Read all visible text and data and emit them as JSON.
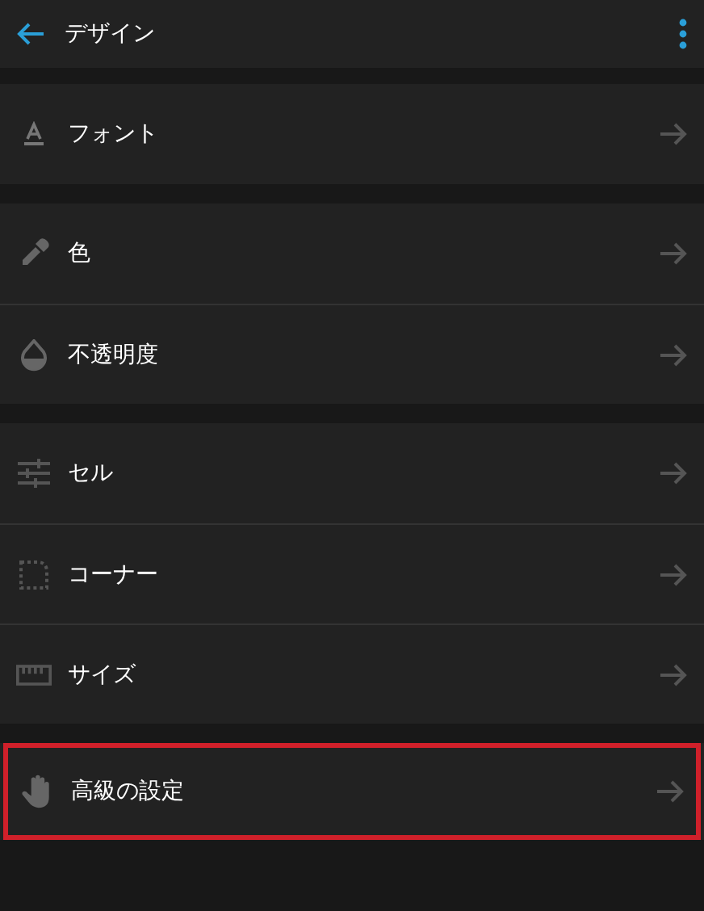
{
  "header": {
    "title": "デザイン"
  },
  "groups": [
    {
      "items": [
        {
          "kind": "font",
          "label": "フォント",
          "selected": false
        }
      ]
    },
    {
      "items": [
        {
          "kind": "dropper",
          "label": "色",
          "selected": false
        },
        {
          "kind": "drop",
          "label": "不透明度",
          "selected": false
        }
      ]
    },
    {
      "items": [
        {
          "kind": "sliders",
          "label": "セル",
          "selected": false
        },
        {
          "kind": "corner",
          "label": "コーナー",
          "selected": false
        },
        {
          "kind": "ruler",
          "label": "サイズ",
          "selected": false
        }
      ]
    },
    {
      "items": [
        {
          "kind": "hand",
          "label": "高級の設定",
          "selected": true
        }
      ]
    }
  ]
}
